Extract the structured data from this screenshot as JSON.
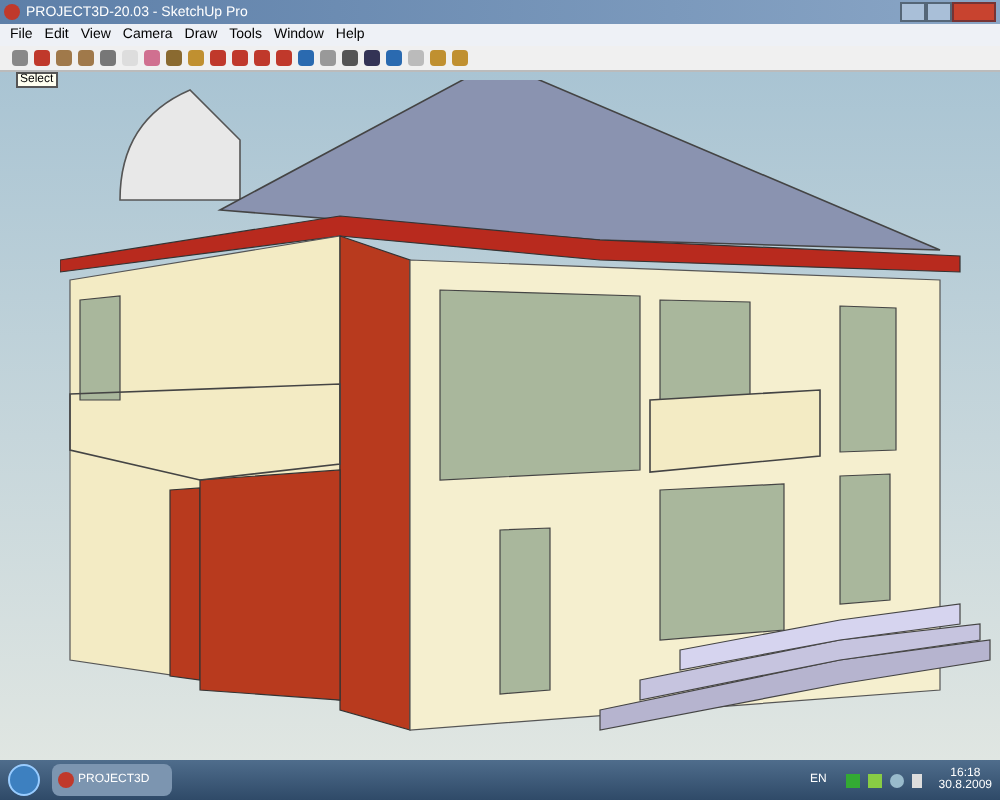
{
  "window": {
    "title": "PROJECT3D-20.03 - SketchUp Pro"
  },
  "menu": [
    "File",
    "Edit",
    "View",
    "Camera",
    "Draw",
    "Tools",
    "Window",
    "Help"
  ],
  "tooltip": "Select",
  "taskbar": {
    "app": "PROJECT3D",
    "language": "EN",
    "time": "16:18",
    "date": "30.8.2009"
  }
}
